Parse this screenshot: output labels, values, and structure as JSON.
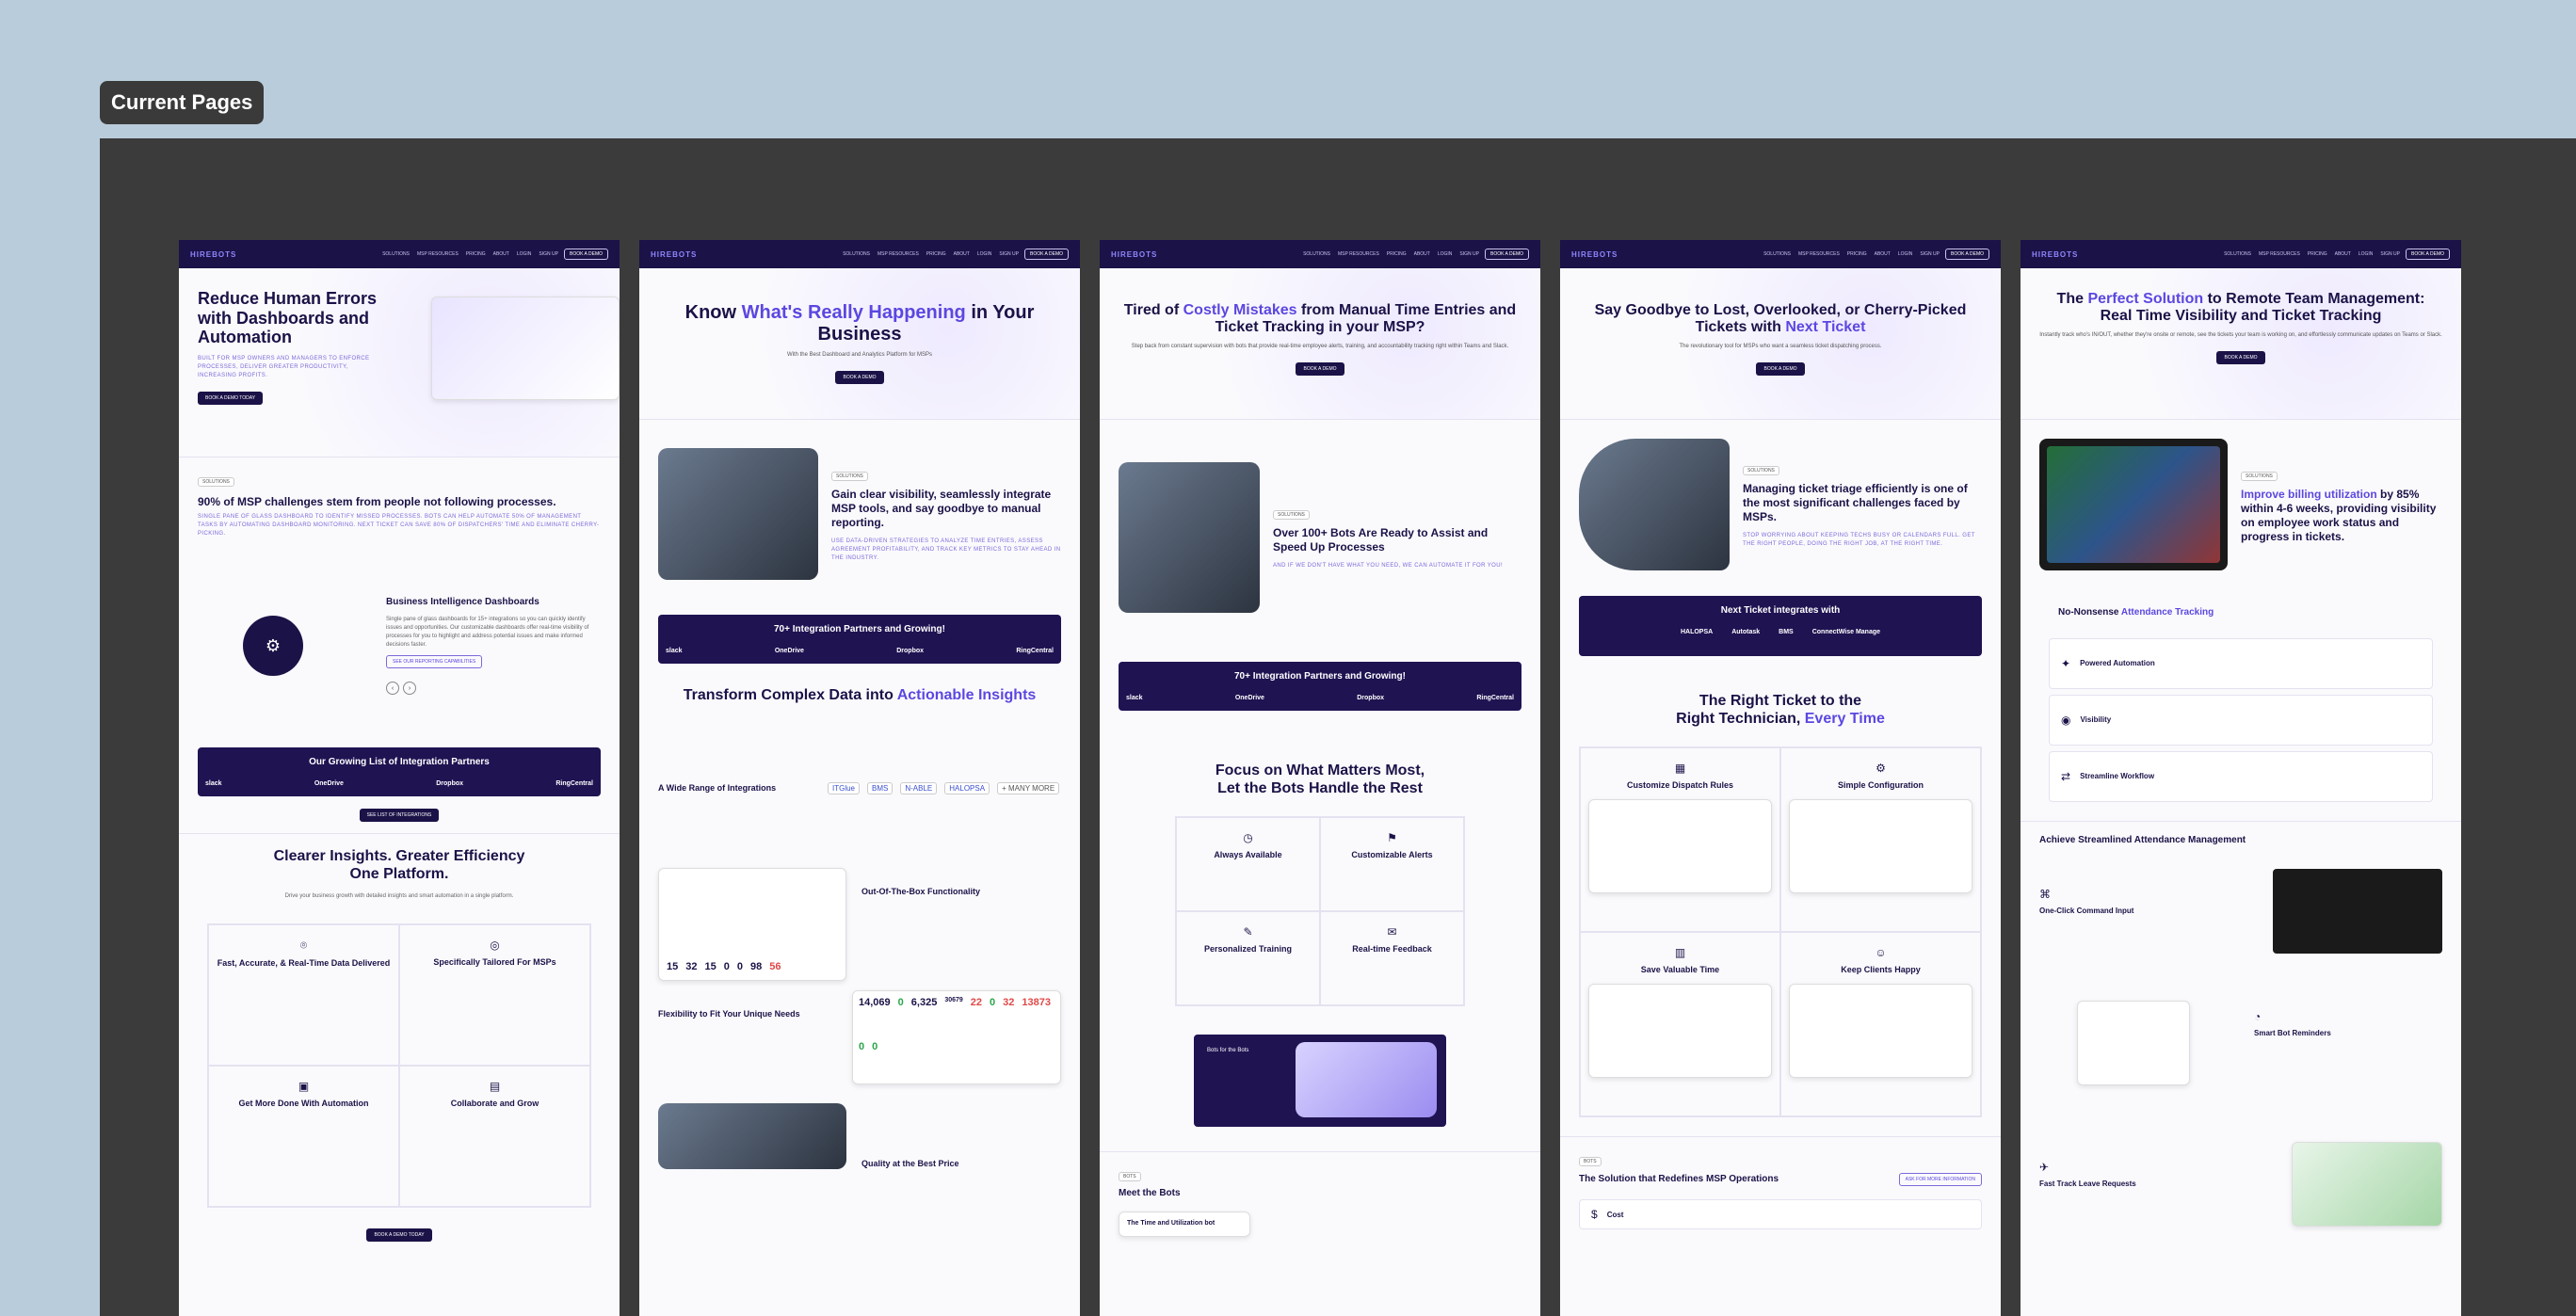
{
  "canvas": {
    "label": "Current Pages"
  },
  "nav": {
    "logo": "HIREBOTS",
    "links": [
      "SOLUTIONS",
      "MSP RESOURCES",
      "PRICING",
      "ABOUT",
      "LOGIN",
      "SIGN UP"
    ],
    "cta": "BOOK A DEMO"
  },
  "pages": [
    {
      "hero_title": "Reduce Human Errors with Dashboards and Automation",
      "hero_sub": "BUILT FOR MSP OWNERS AND MANAGERS TO ENFORCE PROCESSES, DELIVER GREATER PRODUCTIVITY, INCREASING PROFITS.",
      "hero_btn": "BOOK A DEMO TODAY",
      "tag": "SOLUTIONS",
      "challenge_title": "90% of MSP challenges stem from people not following processes.",
      "challenge_sub": "SINGLE PANE OF GLASS DASHBOARD TO IDENTIFY MISSED PROCESSES. BOTS CAN HELP AUTOMATE 50% OF MANAGEMENT TASKS BY AUTOMATING DASHBOARD MONITORING. NEXT TICKET CAN SAVE 80% OF DISPATCHERS' TIME AND ELIMINATE CHERRY-PICKING.",
      "bi_title": "Business Intelligence Dashboards",
      "bi_body": "Single pane of glass dashboards for 15+ integrations so you can quickly identify issues and opportunities. Our customizable dashboards offer real-time visibility of processes for you to highlight and address potential issues and make informed decisions faster.",
      "bi_btn": "SEE OUR REPORTING CAPABILITIES",
      "integrations_title": "Our Growing List of Integration Partners",
      "integrations_btn": "SEE LIST OF INTEGRATIONS",
      "insights_title_1": "Clearer Insights. Greater Efficiency",
      "insights_title_2": "One Platform.",
      "insights_sub": "Drive your business growth with detailed insights and smart automation in a single platform.",
      "features": [
        {
          "icon": "gauge-icon",
          "title": "Fast, Accurate, & Real-Time Data Delivered"
        },
        {
          "icon": "target-icon",
          "title": "Specifically Tailored For MSPs"
        },
        {
          "icon": "robot-icon",
          "title": "Get More Done With Automation"
        },
        {
          "icon": "chart-icon",
          "title": "Collaborate and Grow"
        }
      ],
      "bottom_btn": "BOOK A DEMO TODAY"
    },
    {
      "hero_title_1": "Know",
      "hero_title_accent": "What's Really Happening",
      "hero_title_2": "in Your Business",
      "hero_sub": "With the Best Dashboard and Analytics Platform for MSPs",
      "hero_btn": "BOOK A DEMO",
      "tag": "SOLUTIONS",
      "visibility_title": "Gain clear visibility, seamlessly integrate MSP tools, and say goodbye to manual reporting.",
      "visibility_sub": "USE DATA-DRIVEN STRATEGIES TO ANALYZE TIME ENTRIES, ASSESS AGREEMENT PROFITABILITY, AND TRACK KEY METRICS TO STAY AHEAD IN THE INDUSTRY.",
      "band_title": "70+ Integration Partners and Growing!",
      "transform_title_1": "Transform Complex Data into",
      "transform_title_accent": "Actionable Insights",
      "range_title": "A Wide Range of Integrations",
      "partners": [
        "ITGlue",
        "BMS",
        "N-ABLE",
        "HALOPSA",
        "+ MANY MORE"
      ],
      "stats_a": [
        "15",
        "32",
        "15",
        "0",
        "0",
        "98",
        "56"
      ],
      "ootb_title": "Out-Of-The-Box Functionality",
      "flex_title": "Flexibility to Fit Your Unique Needs",
      "stats_b": [
        "14,069",
        "0",
        "6,325",
        "30679",
        "22",
        "0",
        "32",
        "13873",
        "0",
        "0"
      ],
      "price_title": "Quality at the Best Price"
    },
    {
      "hero_title_1": "Tired of",
      "hero_title_accent": "Costly Mistakes",
      "hero_title_2": "from Manual Time Entries and Ticket Tracking in your MSP?",
      "hero_sub": "Step back from constant supervision with bots that provide real-time employee alerts, training, and accountability tracking right within Teams and Slack.",
      "hero_btn": "BOOK A DEMO",
      "tag": "SOLUTIONS",
      "bots_title": "Over 100+ Bots Are Ready to Assist and Speed Up Processes",
      "bots_sub": "AND IF WE DON'T HAVE WHAT YOU NEED, WE CAN AUTOMATE IT FOR YOU!",
      "band_title": "70+ Integration Partners and Growing!",
      "focus_title_1": "Focus on What Matters Most,",
      "focus_title_accent": "Let the Bots Handle the Rest",
      "focus_cards": [
        "Always Available",
        "Customizable Alerts",
        "Personalized Training",
        "Real-time Feedback"
      ],
      "slider_caption": "Bots for the Bots",
      "meet_tag": "BOTS",
      "meet_title": "Meet the Bots",
      "bot_card_title": "The Time and Utilization bot"
    },
    {
      "hero_title": "Say Goodbye to Lost, Overlooked, or Cherry-Picked Tickets with",
      "hero_title_accent": "Next Ticket",
      "hero_sub": "The revolutionary tool for MSPs who want a seamless ticket dispatching process.",
      "hero_btn": "BOOK A DEMO",
      "tag": "SOLUTIONS",
      "triage_title": "Managing ticket triage efficiently is one of the most significant challenges faced by MSPs.",
      "triage_sub": "STOP WORRYING ABOUT KEEPING TECHS BUSY OR CALENDARS FULL. GET THE RIGHT PEOPLE, DOING THE RIGHT JOB, AT THE RIGHT TIME.",
      "band_title": "Next Ticket integrates with",
      "band_logos": [
        "HALOPSA",
        "Autotask",
        "BMS",
        "ConnectWise Manage"
      ],
      "right_title_1": "The Right Ticket to the",
      "right_title_2": "Right Technician,",
      "right_title_accent": "Every Time",
      "cards": [
        "Customize Dispatch Rules",
        "Simple Configuration",
        "Save Valuable Time",
        "Keep Clients Happy"
      ],
      "bots_tag": "BOTS",
      "solution_title": "The Solution that Redefines MSP Operations",
      "solution_btn": "ASK FOR MORE INFORMATION",
      "cost_title": "Cost"
    },
    {
      "hero_title_1": "The",
      "hero_title_accent": "Perfect Solution",
      "hero_title_2": "to Remote Team Management: Real Time Visibility and Ticket Tracking",
      "hero_sub": "Instantly track who's IN/OUT, whether they're onsite or remote, see the tickets your team is working on, and effortlessly communicate updates on Teams or Slack.",
      "hero_btn": "BOOK A DEMO",
      "tag": "SOLUTIONS",
      "billing_accent": "Improve billing utilization",
      "billing_title": "by 85% within 4-6 weeks, providing visibility on employee work status and progress in tickets.",
      "nonsense_title": "No-Nonsense",
      "nonsense_accent": "Attendance Tracking",
      "tracking_cards": [
        "Powered Automation",
        "Visibility",
        "Streamline Workflow"
      ],
      "achieve_title": "Achieve Streamlined Attendance Management",
      "steps": [
        "One-Click Command Input",
        "Smart Bot Reminders",
        "Fast Track Leave Requests"
      ]
    }
  ]
}
